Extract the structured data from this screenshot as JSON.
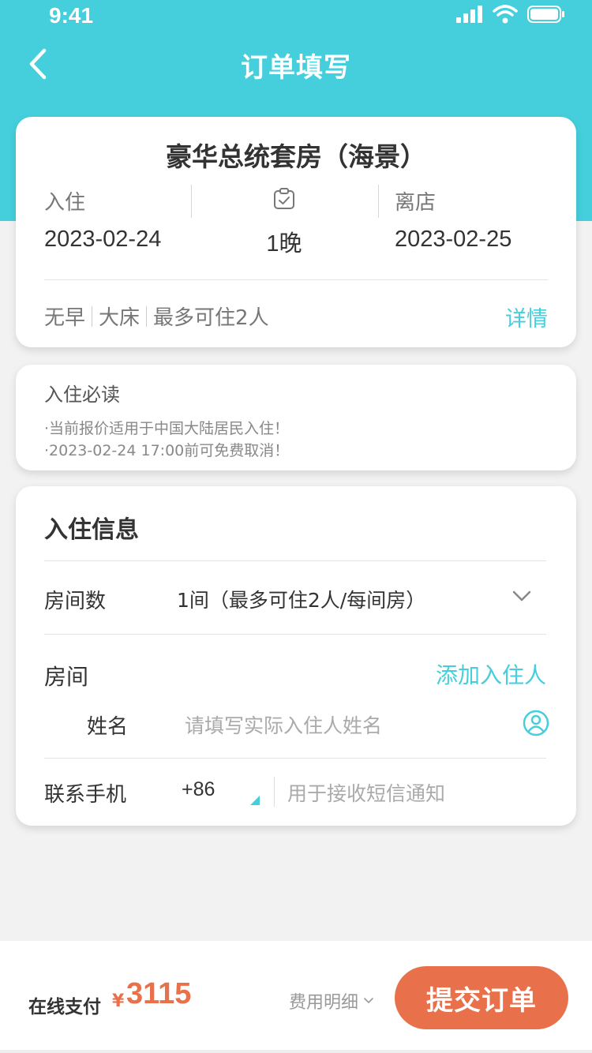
{
  "status_bar": {
    "time": "9:41"
  },
  "nav": {
    "title": "订单填写"
  },
  "room": {
    "name": "豪华总统套房（海景）",
    "checkin_label": "入住",
    "checkin_date": "2023-02-24",
    "nights": "1晚",
    "checkout_label": "离店",
    "checkout_date": "2023-02-25",
    "features": [
      "无早",
      "大床",
      "最多可住2人"
    ],
    "detail_link": "详情"
  },
  "notice": {
    "title": "入住必读",
    "lines": [
      "·当前报价适用于中国大陆居民入住！",
      "·2023-02-24 17:00前可免费取消！"
    ]
  },
  "guest_info": {
    "title": "入住信息",
    "room_count_label": "房间数",
    "room_count_value": "1间（最多可住2人/每间房）",
    "room_label": "房间",
    "add_guest": "添加入住人",
    "name_label": "姓名",
    "name_placeholder": "请填写实际入住人姓名",
    "phone_label": "联系手机",
    "country_code": "+86",
    "phone_placeholder": "用于接收短信通知"
  },
  "bottom": {
    "pay_label": "在线支付",
    "currency": "¥",
    "price": "3115",
    "fee_detail": "费用明细",
    "submit": "提交订单"
  },
  "colors": {
    "accent": "#45cfdc",
    "primary_button": "#e8714c",
    "price": "#e8714c"
  }
}
